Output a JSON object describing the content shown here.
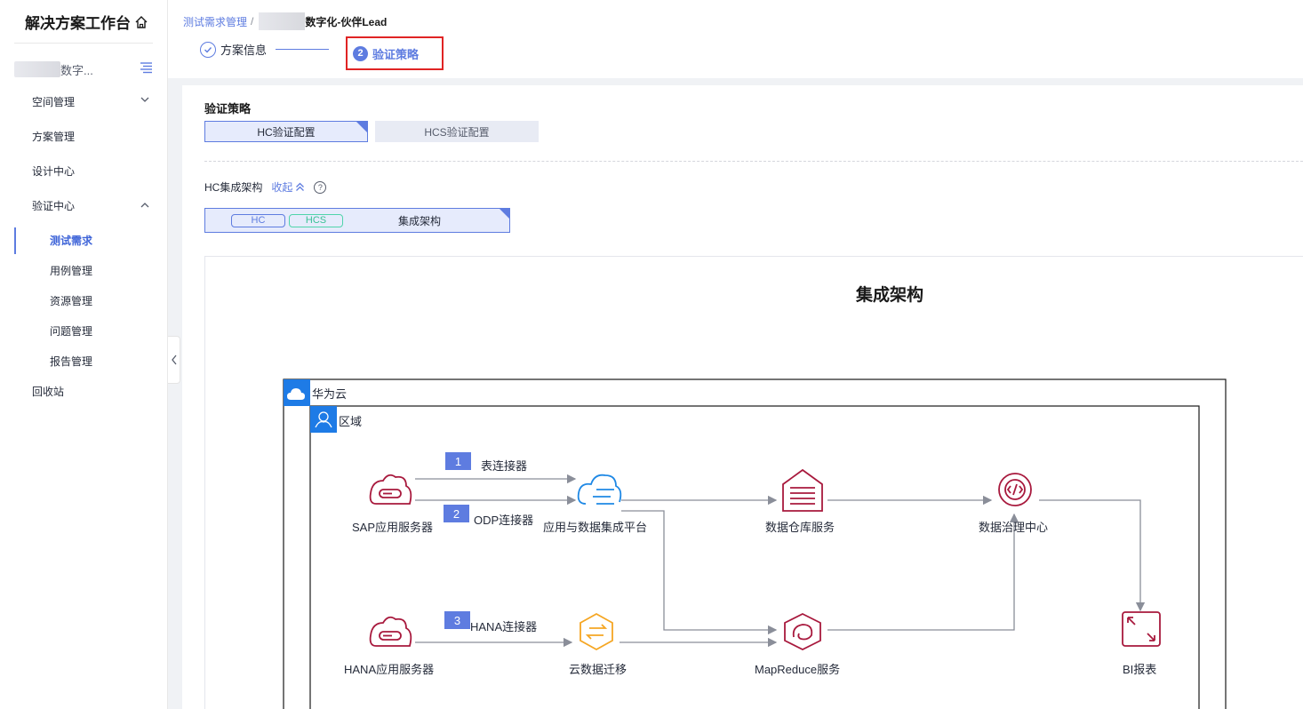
{
  "sidebar": {
    "title": "解决方案工作台",
    "project_suffix": "数字...",
    "items": [
      {
        "label": "空间管理",
        "expandable": true,
        "expanded": false
      },
      {
        "label": "方案管理"
      },
      {
        "label": "设计中心"
      },
      {
        "label": "验证中心",
        "expandable": true,
        "expanded": true
      },
      {
        "label": "测试需求",
        "active": true
      },
      {
        "label": "用例管理"
      },
      {
        "label": "资源管理"
      },
      {
        "label": "问题管理"
      },
      {
        "label": "报告管理"
      },
      {
        "label": "回收站"
      }
    ]
  },
  "header": {
    "breadcrumb_root": "测试需求管理",
    "breadcrumb_sep": "/",
    "breadcrumb_current": "数字化-伙伴Lead",
    "step1_label": "方案信息",
    "step2_num": "2",
    "step2_label": "验证策略"
  },
  "panel": {
    "section_title": "验证策略",
    "tab_hc": "HC验证配置",
    "tab_hcs": "HCS验证配置",
    "hc_arch_label": "HC集成架构",
    "collapse_link": "收起",
    "help": "?",
    "tag_hc": "HC",
    "tag_hcs": "HCS",
    "arch_name": "集成架构"
  },
  "diagram": {
    "title": "集成架构",
    "cloud_label": "华为云",
    "region_label": "区域",
    "nodes": {
      "sap": "SAP应用服务器",
      "hana_server": "HANA应用服务器",
      "integration": "应用与数据集成平台",
      "dws": "数据仓库服务",
      "governance": "数据治理中心",
      "migration": "云数据迁移",
      "mrs": "MapReduce服务",
      "bi": "BI报表"
    },
    "connectors": [
      {
        "num": "1",
        "label": "表连接器"
      },
      {
        "num": "2",
        "label": "ODP连接器"
      },
      {
        "num": "3",
        "label": "HANA连接器"
      }
    ],
    "colors": {
      "accent": "#5e7ce0",
      "red_icon": "#a8193d",
      "orange_icon": "#f5a623",
      "blue_icon": "#1e88e5",
      "line": "#8a8e99"
    }
  }
}
